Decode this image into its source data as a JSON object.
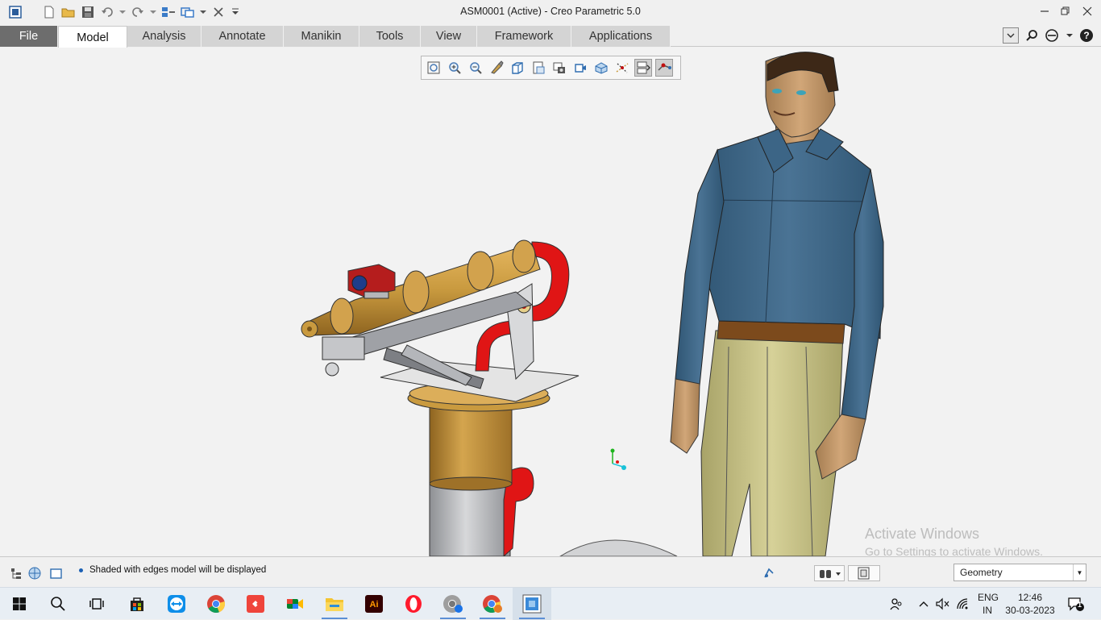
{
  "window": {
    "title": "ASM0001 (Active) - Creo Parametric 5.0"
  },
  "ribbon": {
    "tabs": [
      {
        "label": "File"
      },
      {
        "label": "Model"
      },
      {
        "label": "Analysis"
      },
      {
        "label": "Annotate"
      },
      {
        "label": "Manikin"
      },
      {
        "label": "Tools"
      },
      {
        "label": "View"
      },
      {
        "label": "Framework"
      },
      {
        "label": "Applications"
      }
    ],
    "active_tab": "Model"
  },
  "view_toolbar": {
    "icons": [
      "refit-icon",
      "zoom-in-icon",
      "zoom-out-icon",
      "repaint-icon",
      "saved-orientations-icon",
      "view-manager-icon",
      "display-style-icon",
      "perspective-icon",
      "annotation-display-icon",
      "datum-display-icon",
      "spin-center-icon",
      "active-toggle-icon"
    ]
  },
  "watermark": {
    "line1": "Activate Windows",
    "line2": "Go to Settings to activate Windows."
  },
  "statusbar": {
    "message": "Shaded with edges model will be displayed",
    "filter_value": "Geometry"
  },
  "taskbar": {
    "apps": [
      "windows-start-icon",
      "search-icon",
      "task-view-icon",
      "store-icon",
      "teamviewer-icon",
      "chrome-icon",
      "anydesk-icon",
      "meet-icon",
      "file-explorer-icon",
      "illustrator-icon",
      "opera-icon",
      "chrome-profile-icon",
      "chrome-alt-icon",
      "creo-icon"
    ],
    "lang_top": "ENG",
    "lang_bottom": "IN",
    "time": "12:46",
    "date": "30-03-2023",
    "notification_count": "1"
  },
  "colors": {
    "shirt": "#3f6787",
    "trousers": "#c9c48a",
    "brass": "#c99a3f",
    "red_pipe": "#e01515",
    "steel": "#a9abae"
  }
}
